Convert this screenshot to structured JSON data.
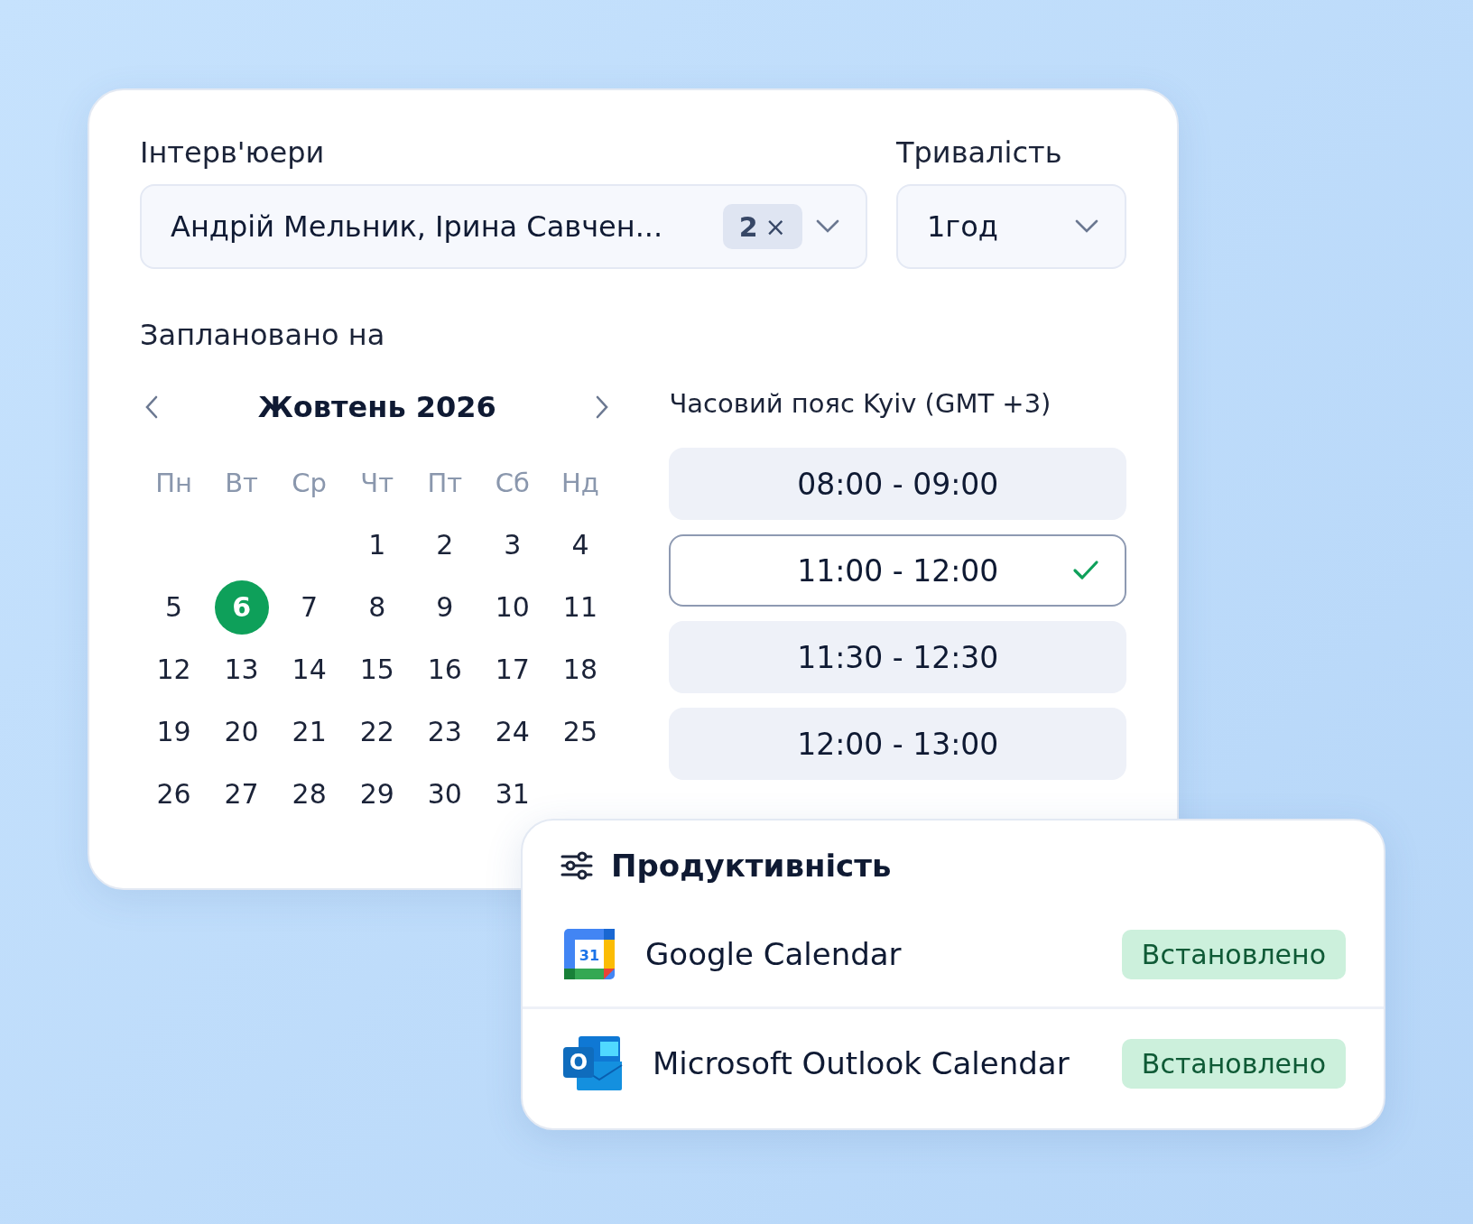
{
  "interviewers": {
    "label": "Інтерв'юери",
    "value": "Андрій Мельник, Ірина Савчен...",
    "count": "2",
    "clear": "×"
  },
  "duration": {
    "label": "Тривалість",
    "value": "1год"
  },
  "scheduled": {
    "label": "Заплановано на"
  },
  "calendar": {
    "month": "Жовтень 2026",
    "weekdays": [
      "Пн",
      "Вт",
      "Ср",
      "Чт",
      "Пт",
      "Сб",
      "Нд"
    ],
    "weeks": [
      {
        "right_aligned": true,
        "days": [
          {
            "day": "1",
            "selected": false
          },
          {
            "day": "2",
            "selected": false
          },
          {
            "day": "3",
            "selected": false
          },
          {
            "day": "4",
            "selected": false
          }
        ]
      },
      {
        "days": [
          {
            "day": "5",
            "selected": false
          },
          {
            "day": "6",
            "selected": true
          },
          {
            "day": "7",
            "selected": false
          },
          {
            "day": "8",
            "selected": false
          },
          {
            "day": "9",
            "selected": false
          },
          {
            "day": "10",
            "selected": false
          },
          {
            "day": "11",
            "selected": false
          }
        ]
      },
      {
        "days": [
          {
            "day": "12",
            "selected": false
          },
          {
            "day": "13",
            "selected": false
          },
          {
            "day": "14",
            "selected": false
          },
          {
            "day": "15",
            "selected": false
          },
          {
            "day": "16",
            "selected": false
          },
          {
            "day": "17",
            "selected": false
          },
          {
            "day": "18",
            "selected": false
          }
        ]
      },
      {
        "days": [
          {
            "day": "19",
            "selected": false
          },
          {
            "day": "20",
            "selected": false
          },
          {
            "day": "21",
            "selected": false
          },
          {
            "day": "22",
            "selected": false
          },
          {
            "day": "23",
            "selected": false
          },
          {
            "day": "24",
            "selected": false
          },
          {
            "day": "25",
            "selected": false
          }
        ]
      },
      {
        "right_aligned": false,
        "days": [
          {
            "day": "26",
            "selected": false
          },
          {
            "day": "27",
            "selected": false
          },
          {
            "day": "28",
            "selected": false
          },
          {
            "day": "29",
            "selected": false
          },
          {
            "day": "30",
            "selected": false
          },
          {
            "day": "31",
            "selected": false
          }
        ]
      }
    ]
  },
  "timezone": "Часовий пояс Kyiv (GMT +3)",
  "slots": [
    {
      "label": "08:00 - 09:00",
      "selected": false
    },
    {
      "label": "11:00 - 12:00",
      "selected": true
    },
    {
      "label": "11:30 - 12:30",
      "selected": false
    },
    {
      "label": "12:00 - 13:00",
      "selected": false
    }
  ],
  "productivity": {
    "title": "Продуктивність",
    "apps": [
      {
        "kind": "google",
        "name": "Google Calendar",
        "logo_text": "31",
        "status": "Встановлено"
      },
      {
        "kind": "outlook",
        "name": "Microsoft Outlook Calendar",
        "logo_text": "O",
        "status": "Встановлено"
      }
    ]
  }
}
